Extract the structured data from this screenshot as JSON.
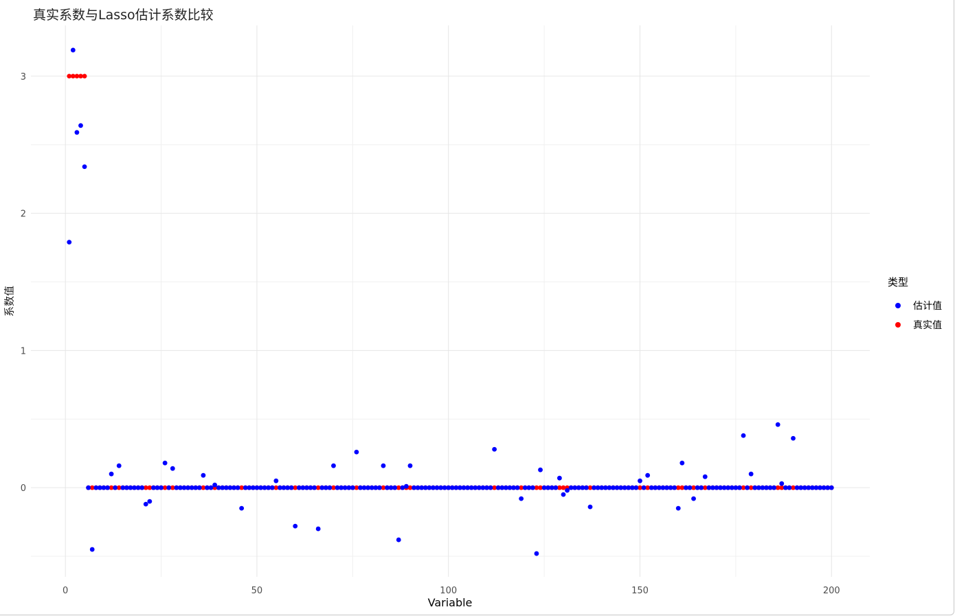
{
  "chart_data": {
    "type": "scatter",
    "title": "真实系数与Lasso估计系数比较",
    "xlabel": "Variable",
    "ylabel": "系数值",
    "xlim": [
      -9,
      210
    ],
    "ylim": [
      -0.65,
      3.37
    ],
    "x_ticks": [
      0,
      50,
      100,
      150,
      200
    ],
    "x_tick_labels": [
      "0",
      "50",
      "100",
      "150",
      "200"
    ],
    "y_ticks": [
      0,
      1,
      2,
      3
    ],
    "y_tick_labels": [
      "0",
      "1",
      "2",
      "3"
    ],
    "grid": true,
    "legend": {
      "title": "类型",
      "position": "right",
      "entries": [
        {
          "label": "估计值",
          "color": "#0000ff"
        },
        {
          "label": "真实值",
          "color": "#ff0000"
        }
      ]
    },
    "series": [
      {
        "name": "估计值",
        "color": "#0000ff",
        "points": [
          [
            1,
            1.79
          ],
          [
            2,
            3.19
          ],
          [
            3,
            2.59
          ],
          [
            4,
            2.64
          ],
          [
            5,
            2.34
          ],
          [
            7,
            -0.45
          ],
          [
            12,
            0.1
          ],
          [
            14,
            0.16
          ],
          [
            21,
            -0.12
          ],
          [
            22,
            -0.1
          ],
          [
            26,
            0.18
          ],
          [
            28,
            0.14
          ],
          [
            36,
            0.09
          ],
          [
            39,
            0.02
          ],
          [
            46,
            -0.15
          ],
          [
            55,
            0.05
          ],
          [
            60,
            -0.28
          ],
          [
            66,
            -0.3
          ],
          [
            70,
            0.16
          ],
          [
            76,
            0.26
          ],
          [
            83,
            0.16
          ],
          [
            87,
            -0.38
          ],
          [
            89,
            0.01
          ],
          [
            90,
            0.16
          ],
          [
            112,
            0.28
          ],
          [
            119,
            -0.08
          ],
          [
            123,
            -0.48
          ],
          [
            124,
            0.13
          ],
          [
            129,
            0.07
          ],
          [
            130,
            -0.05
          ],
          [
            131,
            -0.02
          ],
          [
            137,
            -0.14
          ],
          [
            150,
            0.05
          ],
          [
            152,
            0.09
          ],
          [
            160,
            -0.15
          ],
          [
            161,
            0.18
          ],
          [
            164,
            -0.08
          ],
          [
            167,
            0.08
          ],
          [
            177,
            0.38
          ],
          [
            179,
            0.1
          ],
          [
            186,
            0.46
          ],
          [
            187,
            0.03
          ],
          [
            190,
            0.36
          ]
        ],
        "zero_value": 0,
        "zero_from": 6,
        "zero_to": 200
      },
      {
        "name": "真实值",
        "color": "#ff0000",
        "points": [
          [
            1,
            3
          ],
          [
            2,
            3
          ],
          [
            3,
            3
          ],
          [
            4,
            3
          ],
          [
            5,
            3
          ]
        ],
        "zero_value": 0,
        "zero_from": 6,
        "zero_to": 200
      }
    ]
  }
}
